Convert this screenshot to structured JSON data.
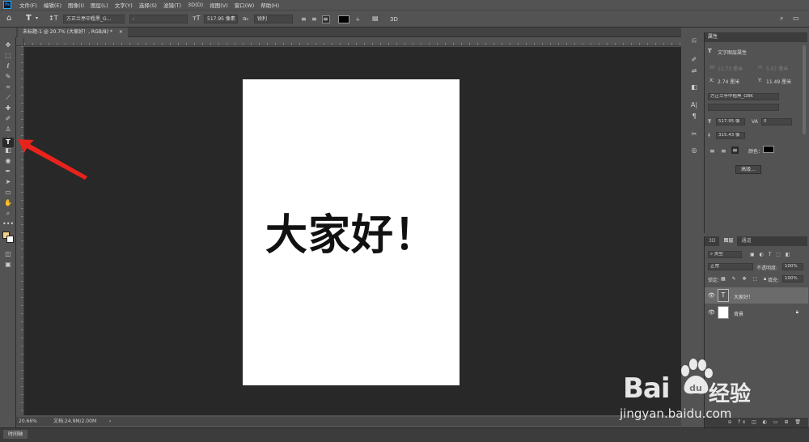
{
  "app": {
    "logo": "Ps",
    "menu": [
      "文件(F)",
      "编辑(E)",
      "图像(I)",
      "图层(L)",
      "文字(Y)",
      "选择(S)",
      "滤镜(T)",
      "3D(D)",
      "视图(V)",
      "窗口(W)",
      "帮助(H)"
    ]
  },
  "options_bar": {
    "font_family": "方正兰亭中粗黑_G...",
    "font_style": "-",
    "font_size": "517.95 像素",
    "anti_alias": "锐利",
    "mode_3d": "3D"
  },
  "document": {
    "tab_title": "未标题-1 @ 20.7% (大家好！, RGB/8) *",
    "canvas_text": "大家好！"
  },
  "status": {
    "zoom": "20.66%",
    "doc_info": "文档:24.9M/2.00M",
    "timeline": "时间轴"
  },
  "properties": {
    "title": "属性",
    "section": "文字图层属性",
    "w_label": "W:",
    "w_value": "11.73 厘米",
    "h_label": "H:",
    "h_value": "5.07 厘米",
    "x_label": "X:",
    "x_value": "2.74 厘米",
    "y_label": "Y:",
    "y_value": "11.49 厘米",
    "font_family": "方正兰亭中粗黑_GBK",
    "font_size": "517.95 像",
    "tracking": "0",
    "leading": "315.43 像",
    "color_label": "颜色：",
    "advanced_button": "高级..."
  },
  "layers_panel": {
    "tabs": [
      "3D",
      "图层",
      "通道"
    ],
    "filter": "类型",
    "blend_mode": "正常",
    "opacity_label": "不透明度:",
    "opacity": "100%",
    "lock_label": "锁定:",
    "fill_label": "填充:",
    "fill": "100%",
    "layers": [
      {
        "name": "大家好！",
        "type": "text",
        "selected": true
      },
      {
        "name": "背景",
        "type": "background",
        "selected": false
      }
    ]
  },
  "watermark": {
    "brand": "Bai",
    "brand_cn": "经验",
    "url": "jingyan.baidu.com"
  },
  "colors": {
    "ui_bg": "#535353",
    "canvas_bg": "#282828",
    "annotation": "#e8231b",
    "foreground_swatch": "#f6d38a",
    "background_swatch": "#ffffff"
  },
  "icons": {
    "tools": [
      "move-icon",
      "marquee-icon",
      "lasso-icon",
      "quick-select-icon",
      "crop-icon",
      "eyedropper-icon",
      "healing-icon",
      "brush-icon",
      "stamp-icon",
      "history-brush-icon",
      "eraser-icon",
      "gradient-icon",
      "type-tool-icon",
      "pen-icon",
      "path-select-icon",
      "rectangle-icon",
      "hand-icon",
      "zoom-icon",
      "more-tools-icon"
    ]
  }
}
